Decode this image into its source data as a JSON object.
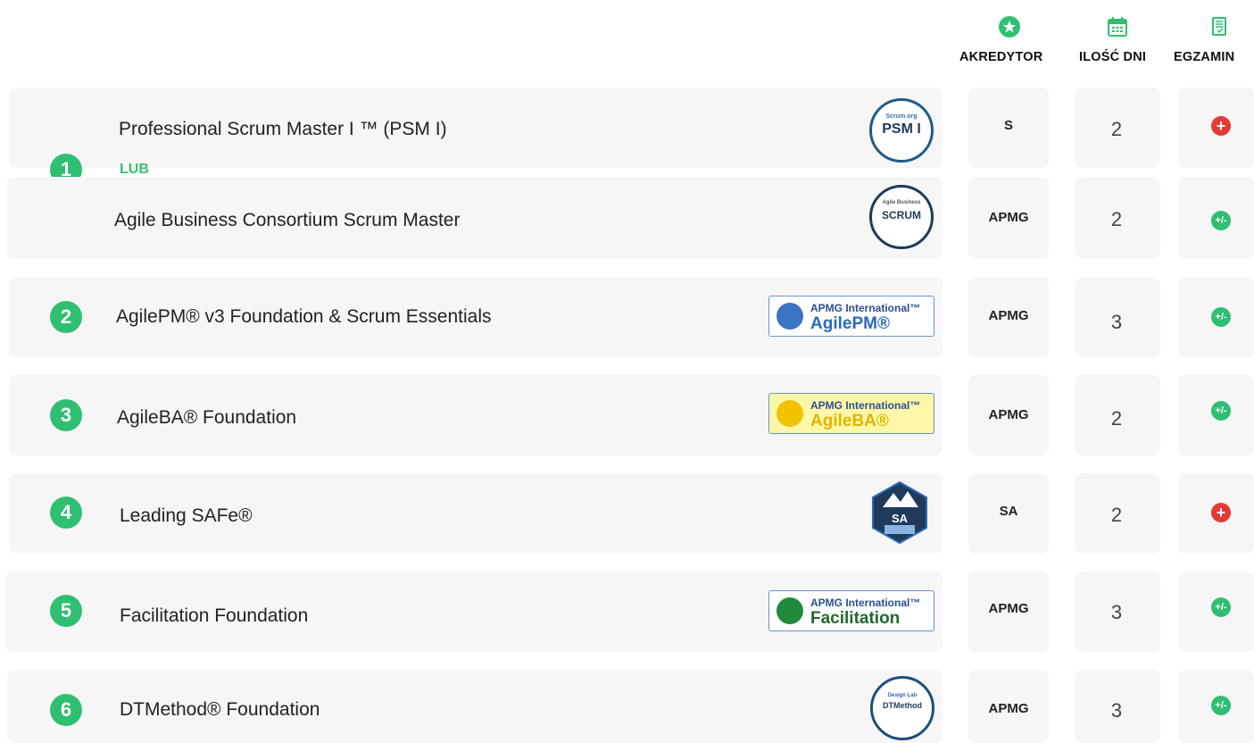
{
  "header": {
    "accreditor_label": "AKREDYTOR",
    "days_label": "ILOŚĆ DNI",
    "exam_label": "EGZAMIN",
    "accent_color": "#2fbf71"
  },
  "separator": "LUB",
  "courses": [
    {
      "number": "1",
      "title": "Professional Scrum Master I ™ (PSM I)",
      "badge": "PSM I",
      "accreditor": "S",
      "days": "2",
      "exam": "included-icon"
    },
    {
      "number": "",
      "title": "Agile Business Consortium Scrum Master",
      "badge": "SCRUM",
      "accreditor": "APMG",
      "days": "2",
      "exam": "optional-icon"
    },
    {
      "number": "2",
      "title": "AgilePM® v3 Foundation & Scrum Essentials",
      "badge_top": "APMG International™",
      "badge_name": "AgilePM®",
      "accreditor": "APMG",
      "days": "3",
      "exam": "optional-icon"
    },
    {
      "number": "3",
      "title": "AgileBA® Foundation",
      "badge_top": "APMG International™",
      "badge_name": "AgileBA®",
      "accreditor": "APMG",
      "days": "2",
      "exam": "optional-icon"
    },
    {
      "number": "4",
      "title": "Leading SAFe®",
      "badge": "SA",
      "accreditor": "SA",
      "days": "2",
      "exam": "included-icon"
    },
    {
      "number": "5",
      "title": "Facilitation Foundation",
      "badge_top": "APMG International™",
      "badge_name": "Facilitation",
      "accreditor": "APMG",
      "days": "3",
      "exam": "optional-icon"
    },
    {
      "number": "6",
      "title": "DTMethod® Foundation",
      "badge": "DTMethod",
      "accreditor": "APMG",
      "days": "3",
      "exam": "optional-icon"
    }
  ],
  "exam_symbols": {
    "included": "+",
    "optional": "+/-"
  }
}
